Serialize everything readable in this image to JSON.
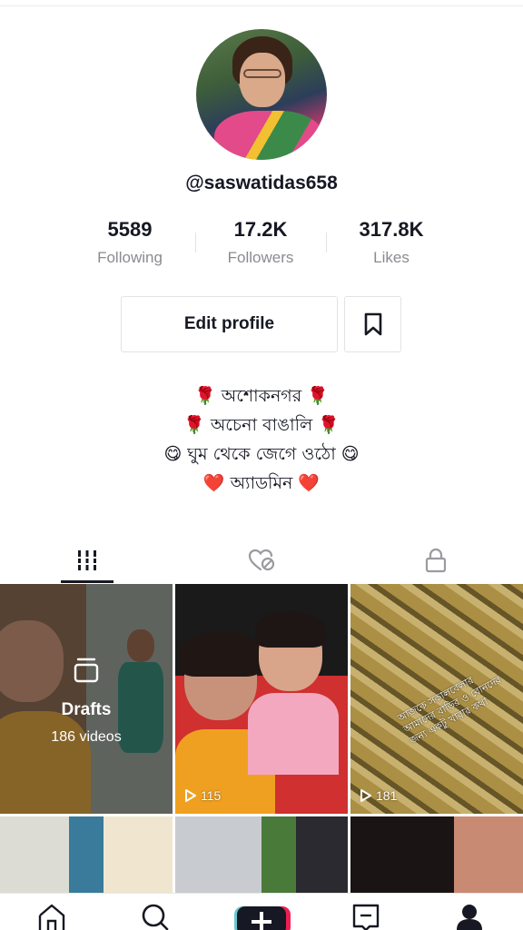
{
  "profile": {
    "username": "@saswatidas658",
    "stats": [
      {
        "value": "5589",
        "label": "Following"
      },
      {
        "value": "17.2K",
        "label": "Followers"
      },
      {
        "value": "317.8K",
        "label": "Likes"
      }
    ],
    "edit_label": "Edit profile",
    "bio": [
      "🌹 অশোকনগর 🌹",
      "🌹 অচেনা বাঙালি 🌹",
      "😋 ঘুম থেকে জেগে ওঠো 😋",
      "❤️ অ্যাডমিন ❤️"
    ]
  },
  "tabs": [
    {
      "icon": "videos-grid-icon",
      "active": true
    },
    {
      "icon": "liked-heart-icon",
      "active": false
    },
    {
      "icon": "lock-icon",
      "active": false
    }
  ],
  "videos": {
    "drafts_label": "Drafts",
    "drafts_count": "186 videos",
    "items": [
      {
        "views": "115"
      },
      {
        "views": "181",
        "caption": "আজকে সকালবেলার আমাদের বাড়ির ও বোনদের জন্য একটু খাবার কথা"
      }
    ]
  },
  "bottom_nav": [
    "home-icon",
    "search-icon",
    "create-icon",
    "inbox-icon",
    "profile-icon"
  ],
  "colors": {
    "text": "#161823",
    "muted": "#8a8b91",
    "border": "#e3e3e4",
    "accent_left": "#69c9d0",
    "accent_right": "#ee1d52"
  }
}
